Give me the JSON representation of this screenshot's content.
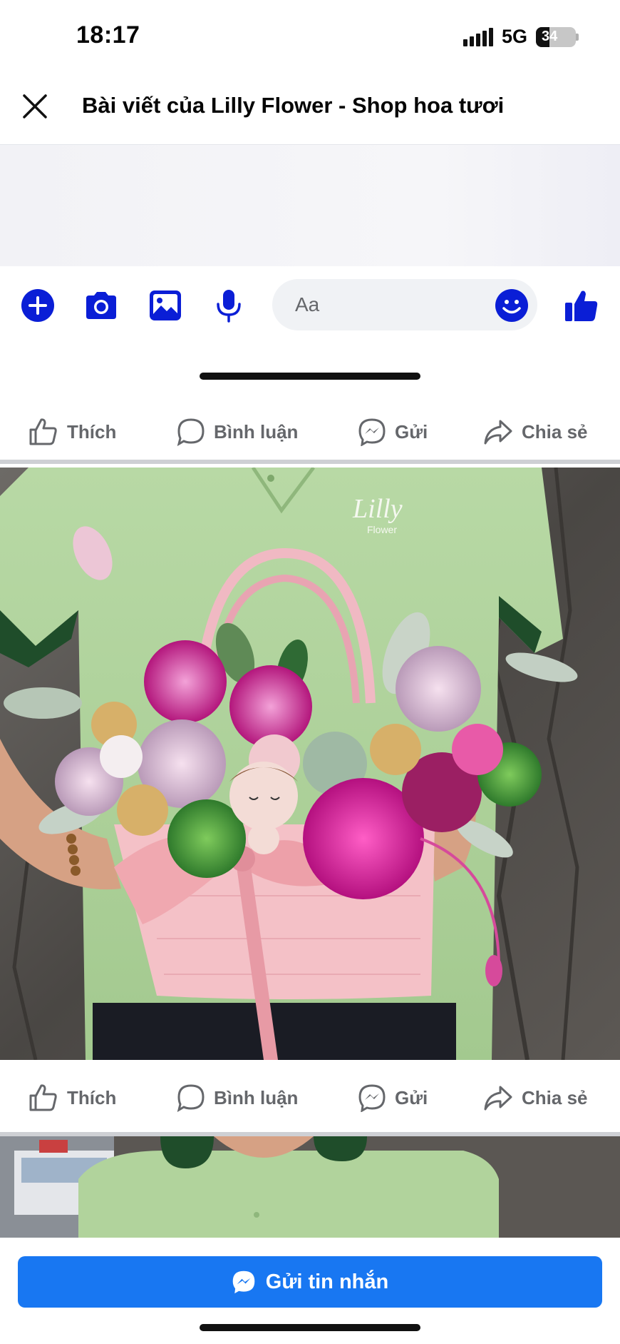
{
  "status_bar": {
    "time": "18:17",
    "network": "5G",
    "battery": "34",
    "battery_level": 0.34
  },
  "header": {
    "title": "Bài viết của Lilly Flower - Shop hoa tươi",
    "close_icon": "close-icon"
  },
  "composer": {
    "placeholder": "Aa",
    "icons": [
      "plus-circle-icon",
      "camera-icon",
      "image-icon",
      "microphone-icon",
      "emoji-icon",
      "thumbs-up-icon"
    ],
    "accent_color": "#0a1ed6"
  },
  "post_actions": [
    {
      "label": "Thích",
      "icon": "like-icon"
    },
    {
      "label": "Bình luận",
      "icon": "comment-icon"
    },
    {
      "label": "Gửi",
      "icon": "messenger-icon"
    },
    {
      "label": "Chia sẻ",
      "icon": "share-icon"
    }
  ],
  "photo": {
    "shirt_logo": "Lilly",
    "shirt_logo_sub": "Flower"
  },
  "send_button": {
    "label": "Gửi tin nhắn",
    "icon": "messenger-icon",
    "color": "#1877f2"
  }
}
